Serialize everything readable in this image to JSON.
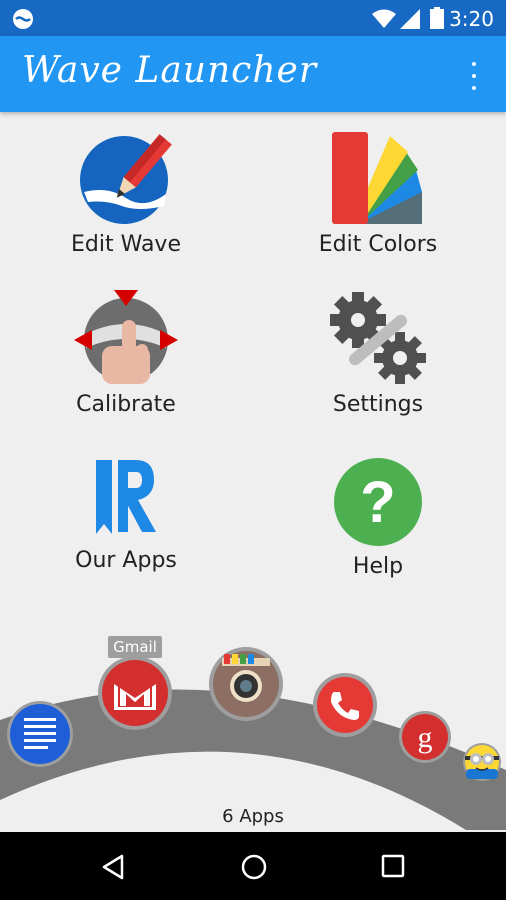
{
  "status_bar": {
    "time": "3:20"
  },
  "app_bar": {
    "title": "Wave Launcher",
    "overflow_icon": "more-vert-icon"
  },
  "menu": [
    {
      "label": "Edit Wave",
      "icon": "edit-wave-icon"
    },
    {
      "label": "Edit Colors",
      "icon": "palette-icon"
    },
    {
      "label": "Calibrate",
      "icon": "calibrate-icon"
    },
    {
      "label": "Settings",
      "icon": "gear-icon"
    },
    {
      "label": "Our Apps",
      "icon": "our-apps-icon"
    },
    {
      "label": "Help",
      "icon": "help-icon"
    }
  ],
  "dock": {
    "hovered_app_label": "Gmail",
    "apps": [
      "docs-icon",
      "gmail-icon",
      "camera-icon",
      "phone-icon",
      "google-plus-icon",
      "minion-icon"
    ],
    "count_label": "6 Apps"
  },
  "nav_bar": {
    "buttons": [
      "back-icon",
      "home-icon",
      "recents-icon"
    ]
  },
  "colors": {
    "status_bar": "#1769c3",
    "app_bar": "#2196f3",
    "background": "#efefef"
  }
}
